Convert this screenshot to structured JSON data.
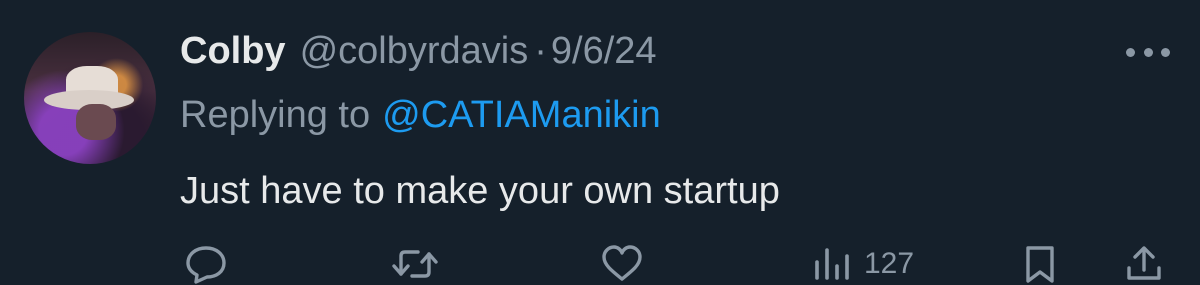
{
  "tweet": {
    "display_name": "Colby",
    "handle": "@colbyrdavis",
    "separator": "·",
    "date": "9/6/24",
    "replying_prefix": "Replying to",
    "replying_handle": "@CATIAManikin",
    "text": "Just have to make your own startup",
    "views": "127"
  },
  "icons": {
    "reply": "reply-icon",
    "retweet": "retweet-icon",
    "like": "heart-icon",
    "views": "views-icon",
    "bookmark": "bookmark-icon",
    "share": "share-icon",
    "more": "more-icon"
  },
  "colors": {
    "background": "#15202b",
    "primary_text": "#e7e9ea",
    "secondary_text": "#8b98a5",
    "link": "#1d9bf0"
  }
}
